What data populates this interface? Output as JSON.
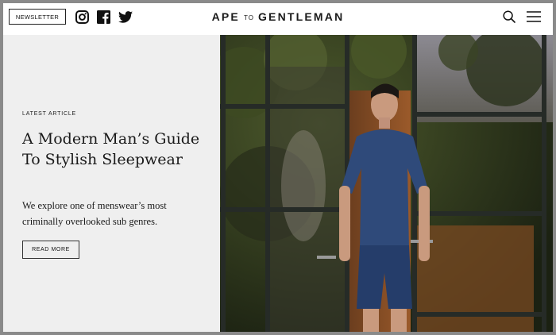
{
  "header": {
    "newsletter_label": "NEWSLETTER",
    "logo_left": "APE",
    "logo_mid": "TO",
    "logo_right": "GENTLEMAN",
    "icons": [
      "instagram-icon",
      "facebook-icon",
      "twitter-icon",
      "search-icon",
      "hamburger-menu-icon"
    ]
  },
  "hero": {
    "kicker": "LATEST ARTICLE",
    "title": "A Modern Man’s Guide To Stylish Sleepwear",
    "excerpt": "We explore one of menswear’s most criminally overlooked sub genres.",
    "read_more_label": "READ MORE"
  },
  "colors": {
    "panel_bg": "#efefef",
    "text": "#1a1a1a",
    "frame": "#8a8a8a"
  }
}
